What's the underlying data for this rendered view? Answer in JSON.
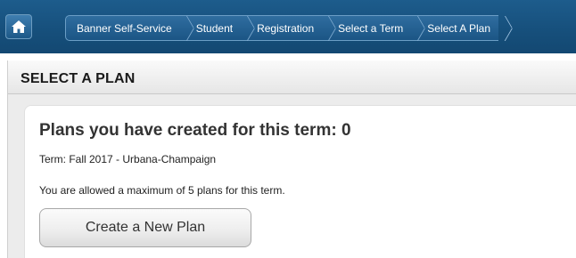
{
  "nav": {
    "home_icon": "home-icon",
    "breadcrumbs": [
      {
        "label": "Banner Self-Service"
      },
      {
        "label": "Student"
      },
      {
        "label": "Registration"
      },
      {
        "label": "Select a Term"
      },
      {
        "label": "Select A Plan"
      }
    ]
  },
  "section": {
    "title": "SELECT A PLAN"
  },
  "card": {
    "heading": "Plans you have created for this term: 0",
    "term_text": "Term: Fall 2017 - Urbana-Champaign",
    "max_plans_text": "You are allowed a maximum of 5 plans for this term.",
    "create_button_label": "Create a New Plan"
  },
  "colors": {
    "nav_bar": "#164f7b",
    "page_bg": "#ececec",
    "card_bg": "#ffffff"
  }
}
